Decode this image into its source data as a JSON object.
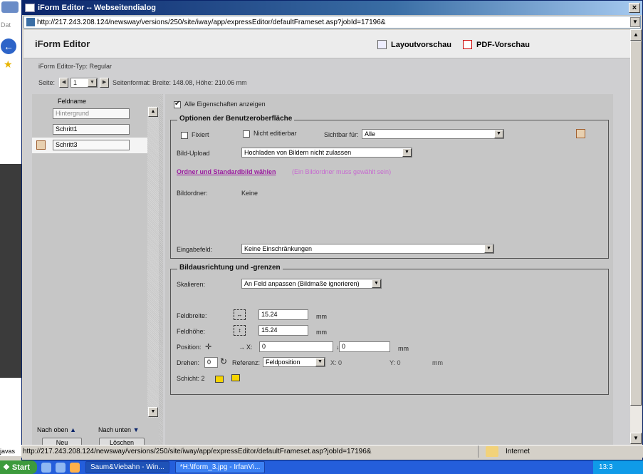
{
  "background": {
    "left_label": "Dat",
    "status_prefix": "javas"
  },
  "window": {
    "title": "iForm Editor -- Webseitendialog",
    "close": "×",
    "url": "http://217.243.208.124/newsway/versions/250/site/iway/app/expressEditor/defaultFrameset.asp?jobId=17196&"
  },
  "header": {
    "app_title": "iForm Editor",
    "layout_preview": "Layoutvorschau",
    "pdf_preview": "PDF-Vorschau"
  },
  "info": {
    "editor_type": "iForm Editor-Typ:  Regular",
    "page_label": "Seite:",
    "page_value": "1",
    "page_format": "Seitenformat: Breite: 148.08, Höhe: 210.06 mm"
  },
  "fields": {
    "header": "Feldname",
    "items": [
      {
        "label": "Hintergrund",
        "active": false
      },
      {
        "label": "Schritt1",
        "active": false
      },
      {
        "label": "Schritt3",
        "active": true
      }
    ],
    "move_up": "Nach oben",
    "move_down": "Nach unten",
    "new": "Neu",
    "delete": "Löschen"
  },
  "props": {
    "show_all": "Alle Eigenschaften anzeigen",
    "ui_options": {
      "title": "Optionen der Benutzeroberfläche",
      "fixed": "Fixiert",
      "not_editable": "Nicht editierbar",
      "visible_for": "Sichtbar für:",
      "visible_for_value": "Alle",
      "image_upload": "Bild-Upload",
      "image_upload_value": "Hochladen von Bildern nicht zulassen",
      "folder_link": "Ordner und Standardbild wählen",
      "folder_hint": "(Ein Bildordner muss gewählt sein)",
      "image_folder": "Bildordner:",
      "image_folder_value": "Keine",
      "input_field": "Eingabefeld:",
      "input_field_value": "Keine Einschränkungen"
    },
    "alignment": {
      "title": "Bildausrichtung und -grenzen",
      "scale": "Skalieren:",
      "scale_value": "An Feld anpassen (Bildmaße ignorieren)",
      "field_width": "Feldbreite:",
      "field_width_value": "15.24",
      "field_height": "Feldhöhe:",
      "field_height_value": "15.24",
      "unit": "mm",
      "position": "Position:",
      "x_label": "X:",
      "x_value": "0",
      "y_label": "Y:",
      "y_value": "0",
      "rotate": "Drehen:",
      "rotate_value": "0",
      "reference": "Referenz:",
      "reference_value": "Feldposition",
      "ref_x": "X:  0",
      "ref_y": "Y:  0",
      "ref_unit": "mm",
      "layer": "Schicht: 2"
    }
  },
  "statusbar": {
    "url": "http://217.243.208.124/newsway/versions/250/site/iway/app/expressEditor/defaultFrameset.asp?jobId=17196&",
    "zone": "Internet"
  },
  "taskbar": {
    "start": "Start",
    "task1": "Saum&Viebahn - Win...",
    "task2": "*H:\\Iform_3.jpg - IrfanVi...",
    "clock": "13:3"
  }
}
